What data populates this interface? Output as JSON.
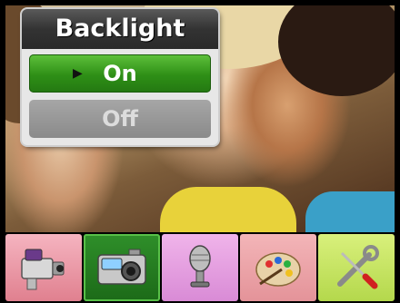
{
  "dialog": {
    "title": "Backlight",
    "options": [
      {
        "label": "On",
        "selected": true
      },
      {
        "label": "Off",
        "selected": false
      }
    ],
    "cursor_glyph": "▶"
  },
  "menu": {
    "items": [
      {
        "icon": "video-camera-icon",
        "color": "#e0808f"
      },
      {
        "icon": "digital-camera-icon",
        "color": "#1c6a18",
        "active": true
      },
      {
        "icon": "microphone-icon",
        "color": "#d98bd6"
      },
      {
        "icon": "paint-palette-icon",
        "color": "#e49399"
      },
      {
        "icon": "wrench-screwdriver-icon",
        "color": "#b4d84c"
      }
    ]
  },
  "colors": {
    "selected_option": "#2e8f16",
    "unselected_option": "#8a8a8a",
    "title_bar": "#333333"
  }
}
